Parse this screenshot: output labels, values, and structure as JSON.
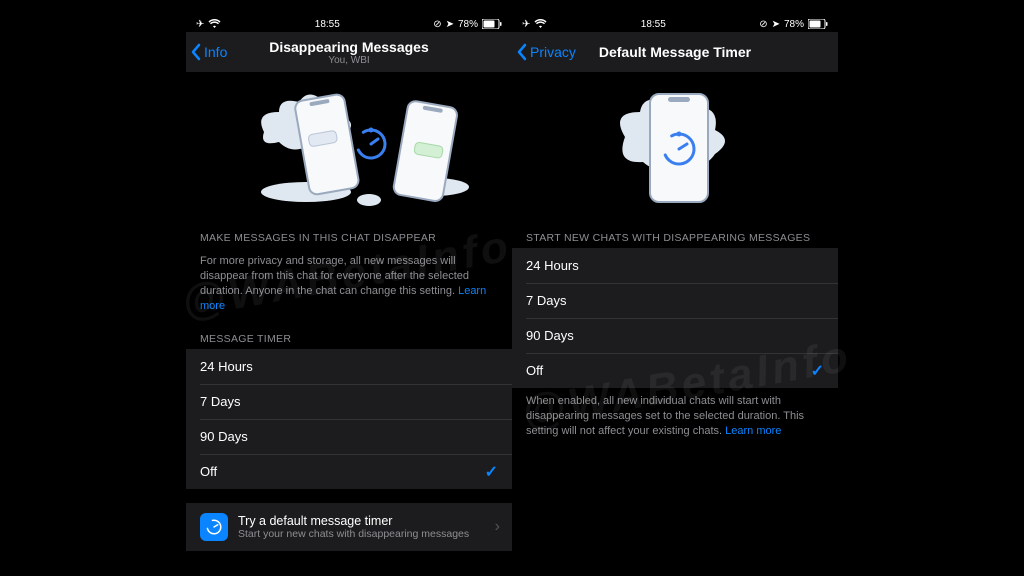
{
  "status": {
    "time": "18:55",
    "battery": "78%"
  },
  "left": {
    "back": "Info",
    "title": "Disappearing Messages",
    "subtitle": "You, WBI",
    "sections": {
      "head1": "MAKE MESSAGES IN THIS CHAT DISAPPEAR",
      "foot1_a": "For more privacy and storage, all new messages will disappear from this chat for everyone after the selected duration. Anyone in the chat can change this setting. ",
      "learn": "Learn more",
      "head2": "MESSAGE TIMER"
    },
    "options": [
      "24 Hours",
      "7 Days",
      "90 Days",
      "Off"
    ],
    "selected": "Off",
    "promo": {
      "title": "Try a default message timer",
      "subtitle": "Start your new chats with disappearing messages"
    }
  },
  "right": {
    "back": "Privacy",
    "title": "Default Message Timer",
    "head": "START NEW CHATS WITH DISAPPEARING MESSAGES",
    "options": [
      "24 Hours",
      "7 Days",
      "90 Days",
      "Off"
    ],
    "selected": "Off",
    "foot_a": "When enabled, all new individual chats will start with disappearing messages set to the selected duration. This setting will not affect your existing chats. ",
    "learn": "Learn more"
  },
  "watermark": "@WABetaInfo"
}
